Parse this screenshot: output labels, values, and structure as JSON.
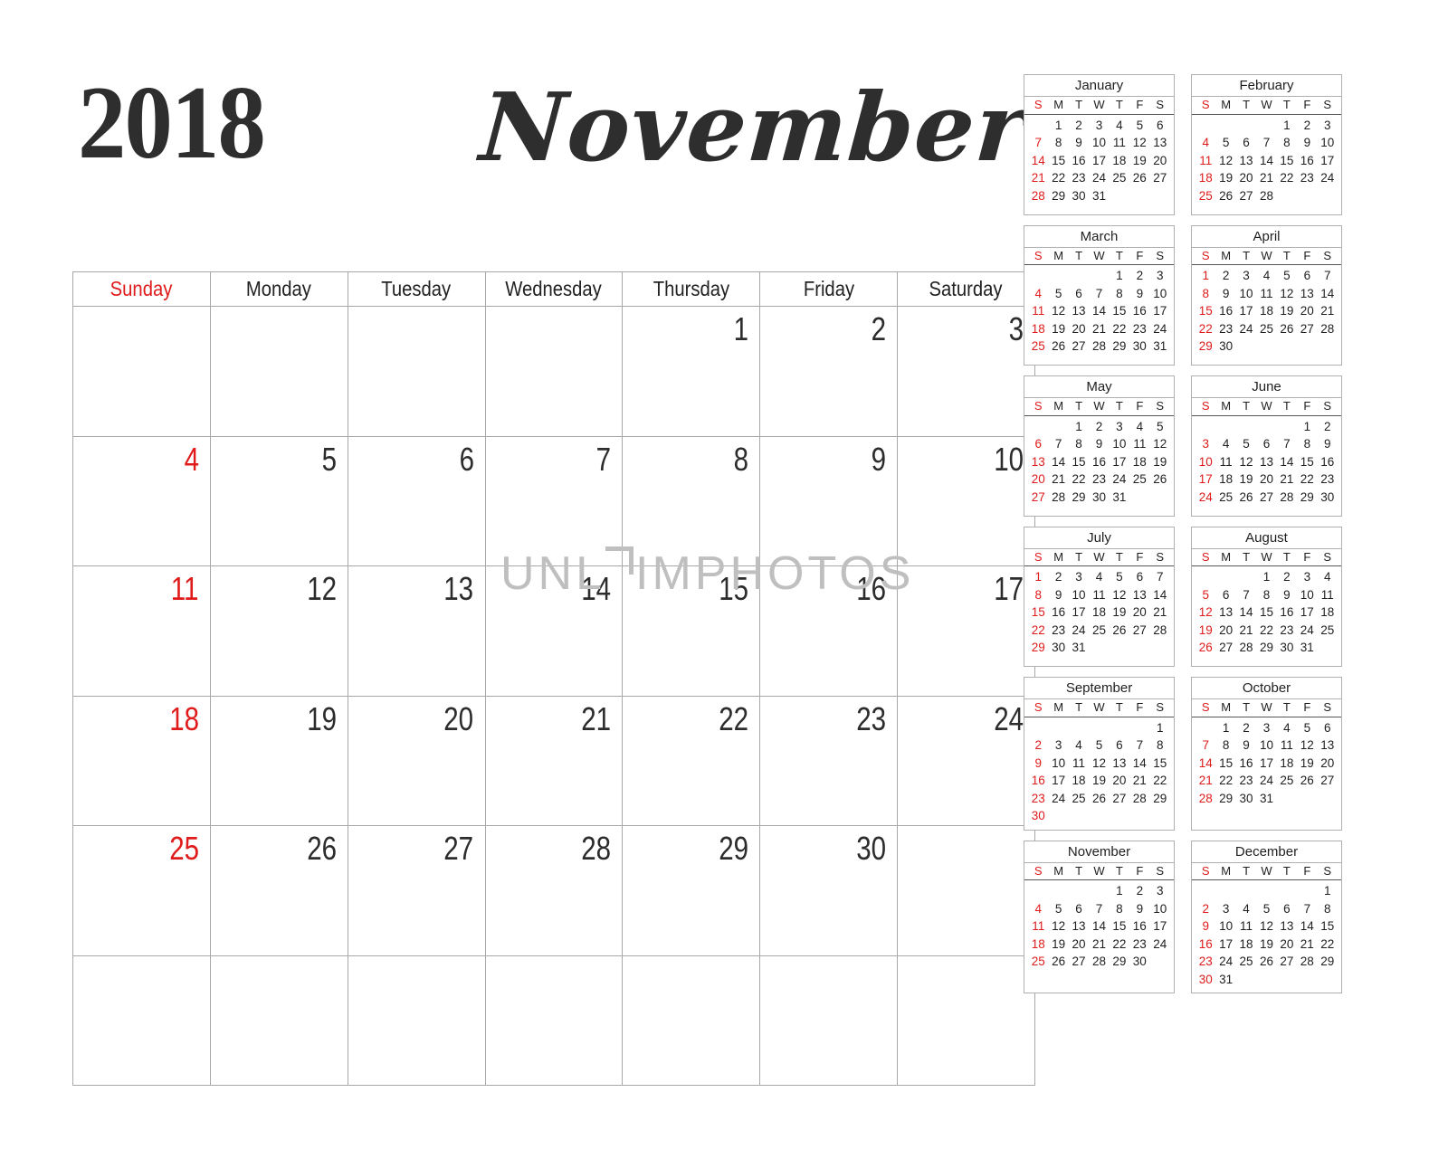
{
  "header": {
    "year": "2018",
    "month": "November"
  },
  "colors": {
    "sunday_red": "#e01b1b",
    "text_dark": "#2d2d2d",
    "grid_line": "#a7a7a7",
    "watermark": "#bfbfbf"
  },
  "watermark": {
    "text_left": "UNL",
    "text_right": "IMPHOTOS",
    "full": "UNLIMPHOTOS"
  },
  "main_calendar": {
    "title": "November 2018",
    "day_headers": [
      "Sunday",
      "Monday",
      "Tuesday",
      "Wednesday",
      "Thursday",
      "Friday",
      "Saturday"
    ],
    "weeks": [
      [
        "",
        "",
        "",
        "",
        "1",
        "2",
        "3"
      ],
      [
        "4",
        "5",
        "6",
        "7",
        "8",
        "9",
        "10"
      ],
      [
        "11",
        "12",
        "13",
        "14",
        "15",
        "16",
        "17"
      ],
      [
        "18",
        "19",
        "20",
        "21",
        "22",
        "23",
        "24"
      ],
      [
        "25",
        "26",
        "27",
        "28",
        "29",
        "30",
        ""
      ],
      [
        "",
        "",
        "",
        "",
        "",
        "",
        ""
      ]
    ]
  },
  "mini_calendars": {
    "dow": [
      "S",
      "M",
      "T",
      "W",
      "T",
      "F",
      "S"
    ],
    "months": [
      {
        "name": "January",
        "weeks": [
          [
            "",
            "1",
            "2",
            "3",
            "4",
            "5",
            "6"
          ],
          [
            "7",
            "8",
            "9",
            "10",
            "11",
            "12",
            "13"
          ],
          [
            "14",
            "15",
            "16",
            "17",
            "18",
            "19",
            "20"
          ],
          [
            "21",
            "22",
            "23",
            "24",
            "25",
            "26",
            "27"
          ],
          [
            "28",
            "29",
            "30",
            "31",
            "",
            "",
            ""
          ]
        ]
      },
      {
        "name": "February",
        "weeks": [
          [
            "",
            "",
            "",
            "",
            "1",
            "2",
            "3"
          ],
          [
            "4",
            "5",
            "6",
            "7",
            "8",
            "9",
            "10"
          ],
          [
            "11",
            "12",
            "13",
            "14",
            "15",
            "16",
            "17"
          ],
          [
            "18",
            "19",
            "20",
            "21",
            "22",
            "23",
            "24"
          ],
          [
            "25",
            "26",
            "27",
            "28",
            "",
            "",
            ""
          ]
        ]
      },
      {
        "name": "March",
        "weeks": [
          [
            "",
            "",
            "",
            "",
            "1",
            "2",
            "3"
          ],
          [
            "4",
            "5",
            "6",
            "7",
            "8",
            "9",
            "10"
          ],
          [
            "11",
            "12",
            "13",
            "14",
            "15",
            "16",
            "17"
          ],
          [
            "18",
            "19",
            "20",
            "21",
            "22",
            "23",
            "24"
          ],
          [
            "25",
            "26",
            "27",
            "28",
            "29",
            "30",
            "31"
          ]
        ]
      },
      {
        "name": "April",
        "weeks": [
          [
            "1",
            "2",
            "3",
            "4",
            "5",
            "6",
            "7"
          ],
          [
            "8",
            "9",
            "10",
            "11",
            "12",
            "13",
            "14"
          ],
          [
            "15",
            "16",
            "17",
            "18",
            "19",
            "20",
            "21"
          ],
          [
            "22",
            "23",
            "24",
            "25",
            "26",
            "27",
            "28"
          ],
          [
            "29",
            "30",
            "",
            "",
            "",
            "",
            ""
          ]
        ]
      },
      {
        "name": "May",
        "weeks": [
          [
            "",
            "",
            "1",
            "2",
            "3",
            "4",
            "5"
          ],
          [
            "6",
            "7",
            "8",
            "9",
            "10",
            "11",
            "12"
          ],
          [
            "13",
            "14",
            "15",
            "16",
            "17",
            "18",
            "19"
          ],
          [
            "20",
            "21",
            "22",
            "23",
            "24",
            "25",
            "26"
          ],
          [
            "27",
            "28",
            "29",
            "30",
            "31",
            "",
            ""
          ]
        ]
      },
      {
        "name": "June",
        "weeks": [
          [
            "",
            "",
            "",
            "",
            "",
            "1",
            "2"
          ],
          [
            "3",
            "4",
            "5",
            "6",
            "7",
            "8",
            "9"
          ],
          [
            "10",
            "11",
            "12",
            "13",
            "14",
            "15",
            "16"
          ],
          [
            "17",
            "18",
            "19",
            "20",
            "21",
            "22",
            "23"
          ],
          [
            "24",
            "25",
            "26",
            "27",
            "28",
            "29",
            "30"
          ]
        ]
      },
      {
        "name": "July",
        "weeks": [
          [
            "1",
            "2",
            "3",
            "4",
            "5",
            "6",
            "7"
          ],
          [
            "8",
            "9",
            "10",
            "11",
            "12",
            "13",
            "14"
          ],
          [
            "15",
            "16",
            "17",
            "18",
            "19",
            "20",
            "21"
          ],
          [
            "22",
            "23",
            "24",
            "25",
            "26",
            "27",
            "28"
          ],
          [
            "29",
            "30",
            "31",
            "",
            "",
            "",
            ""
          ]
        ]
      },
      {
        "name": "August",
        "weeks": [
          [
            "",
            "",
            "",
            "1",
            "2",
            "3",
            "4"
          ],
          [
            "5",
            "6",
            "7",
            "8",
            "9",
            "10",
            "11"
          ],
          [
            "12",
            "13",
            "14",
            "15",
            "16",
            "17",
            "18"
          ],
          [
            "19",
            "20",
            "21",
            "22",
            "23",
            "24",
            "25"
          ],
          [
            "26",
            "27",
            "28",
            "29",
            "30",
            "31",
            ""
          ]
        ]
      },
      {
        "name": "September",
        "weeks": [
          [
            "",
            "",
            "",
            "",
            "",
            "",
            "1"
          ],
          [
            "2",
            "3",
            "4",
            "5",
            "6",
            "7",
            "8"
          ],
          [
            "9",
            "10",
            "11",
            "12",
            "13",
            "14",
            "15"
          ],
          [
            "16",
            "17",
            "18",
            "19",
            "20",
            "21",
            "22"
          ],
          [
            "23",
            "24",
            "25",
            "26",
            "27",
            "28",
            "29"
          ],
          [
            "30",
            "",
            "",
            "",
            "",
            "",
            ""
          ]
        ]
      },
      {
        "name": "October",
        "weeks": [
          [
            "",
            "1",
            "2",
            "3",
            "4",
            "5",
            "6"
          ],
          [
            "7",
            "8",
            "9",
            "10",
            "11",
            "12",
            "13"
          ],
          [
            "14",
            "15",
            "16",
            "17",
            "18",
            "19",
            "20"
          ],
          [
            "21",
            "22",
            "23",
            "24",
            "25",
            "26",
            "27"
          ],
          [
            "28",
            "29",
            "30",
            "31",
            "",
            "",
            ""
          ]
        ]
      },
      {
        "name": "November",
        "weeks": [
          [
            "",
            "",
            "",
            "",
            "1",
            "2",
            "3"
          ],
          [
            "4",
            "5",
            "6",
            "7",
            "8",
            "9",
            "10"
          ],
          [
            "11",
            "12",
            "13",
            "14",
            "15",
            "16",
            "17"
          ],
          [
            "18",
            "19",
            "20",
            "21",
            "22",
            "23",
            "24"
          ],
          [
            "25",
            "26",
            "27",
            "28",
            "29",
            "30",
            ""
          ]
        ]
      },
      {
        "name": "December",
        "weeks": [
          [
            "",
            "",
            "",
            "",
            "",
            "",
            "1"
          ],
          [
            "2",
            "3",
            "4",
            "5",
            "6",
            "7",
            "8"
          ],
          [
            "9",
            "10",
            "11",
            "12",
            "13",
            "14",
            "15"
          ],
          [
            "16",
            "17",
            "18",
            "19",
            "20",
            "21",
            "22"
          ],
          [
            "23",
            "24",
            "25",
            "26",
            "27",
            "28",
            "29"
          ],
          [
            "30",
            "31",
            "",
            "",
            "",
            "",
            ""
          ]
        ]
      }
    ]
  }
}
